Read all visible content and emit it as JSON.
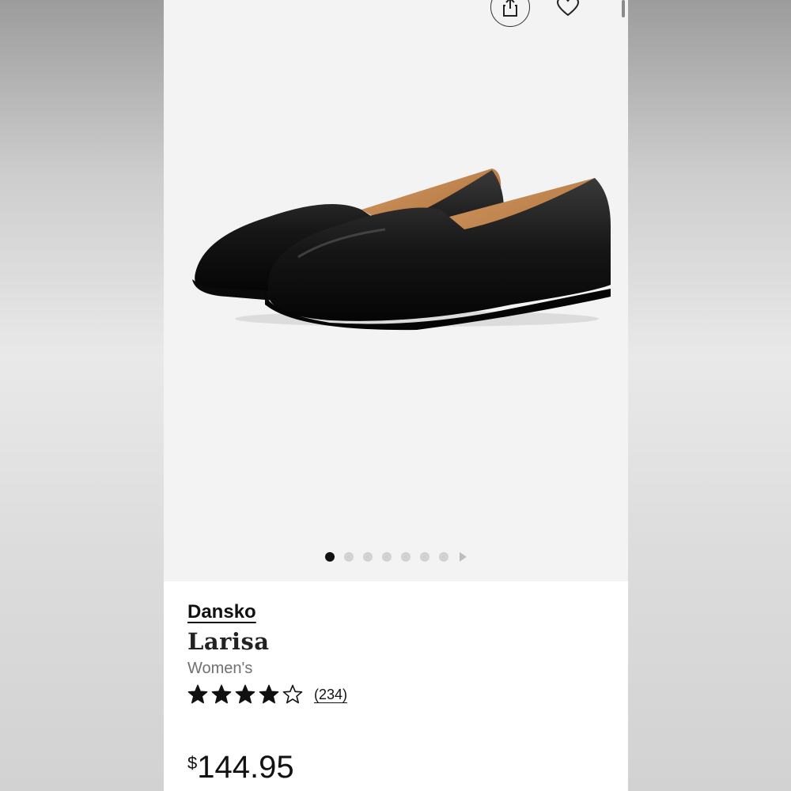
{
  "gallery": {
    "image_alt": "Black leather slip-on flat shoes",
    "dot_count": 7,
    "active_index": 0
  },
  "product": {
    "brand": "Dansko",
    "name": "Larisa",
    "gender": "Women's",
    "rating": 4,
    "rating_max": 5,
    "review_count": "(234)",
    "price_currency": "$",
    "price_amount": "144.95"
  },
  "icons": {
    "share": "share-icon",
    "favorite": "heart-icon",
    "next": "chevron-right-icon"
  },
  "colors": {
    "gallery_bg": "#f3f3f3",
    "text": "#111111",
    "muted": "#707070"
  }
}
